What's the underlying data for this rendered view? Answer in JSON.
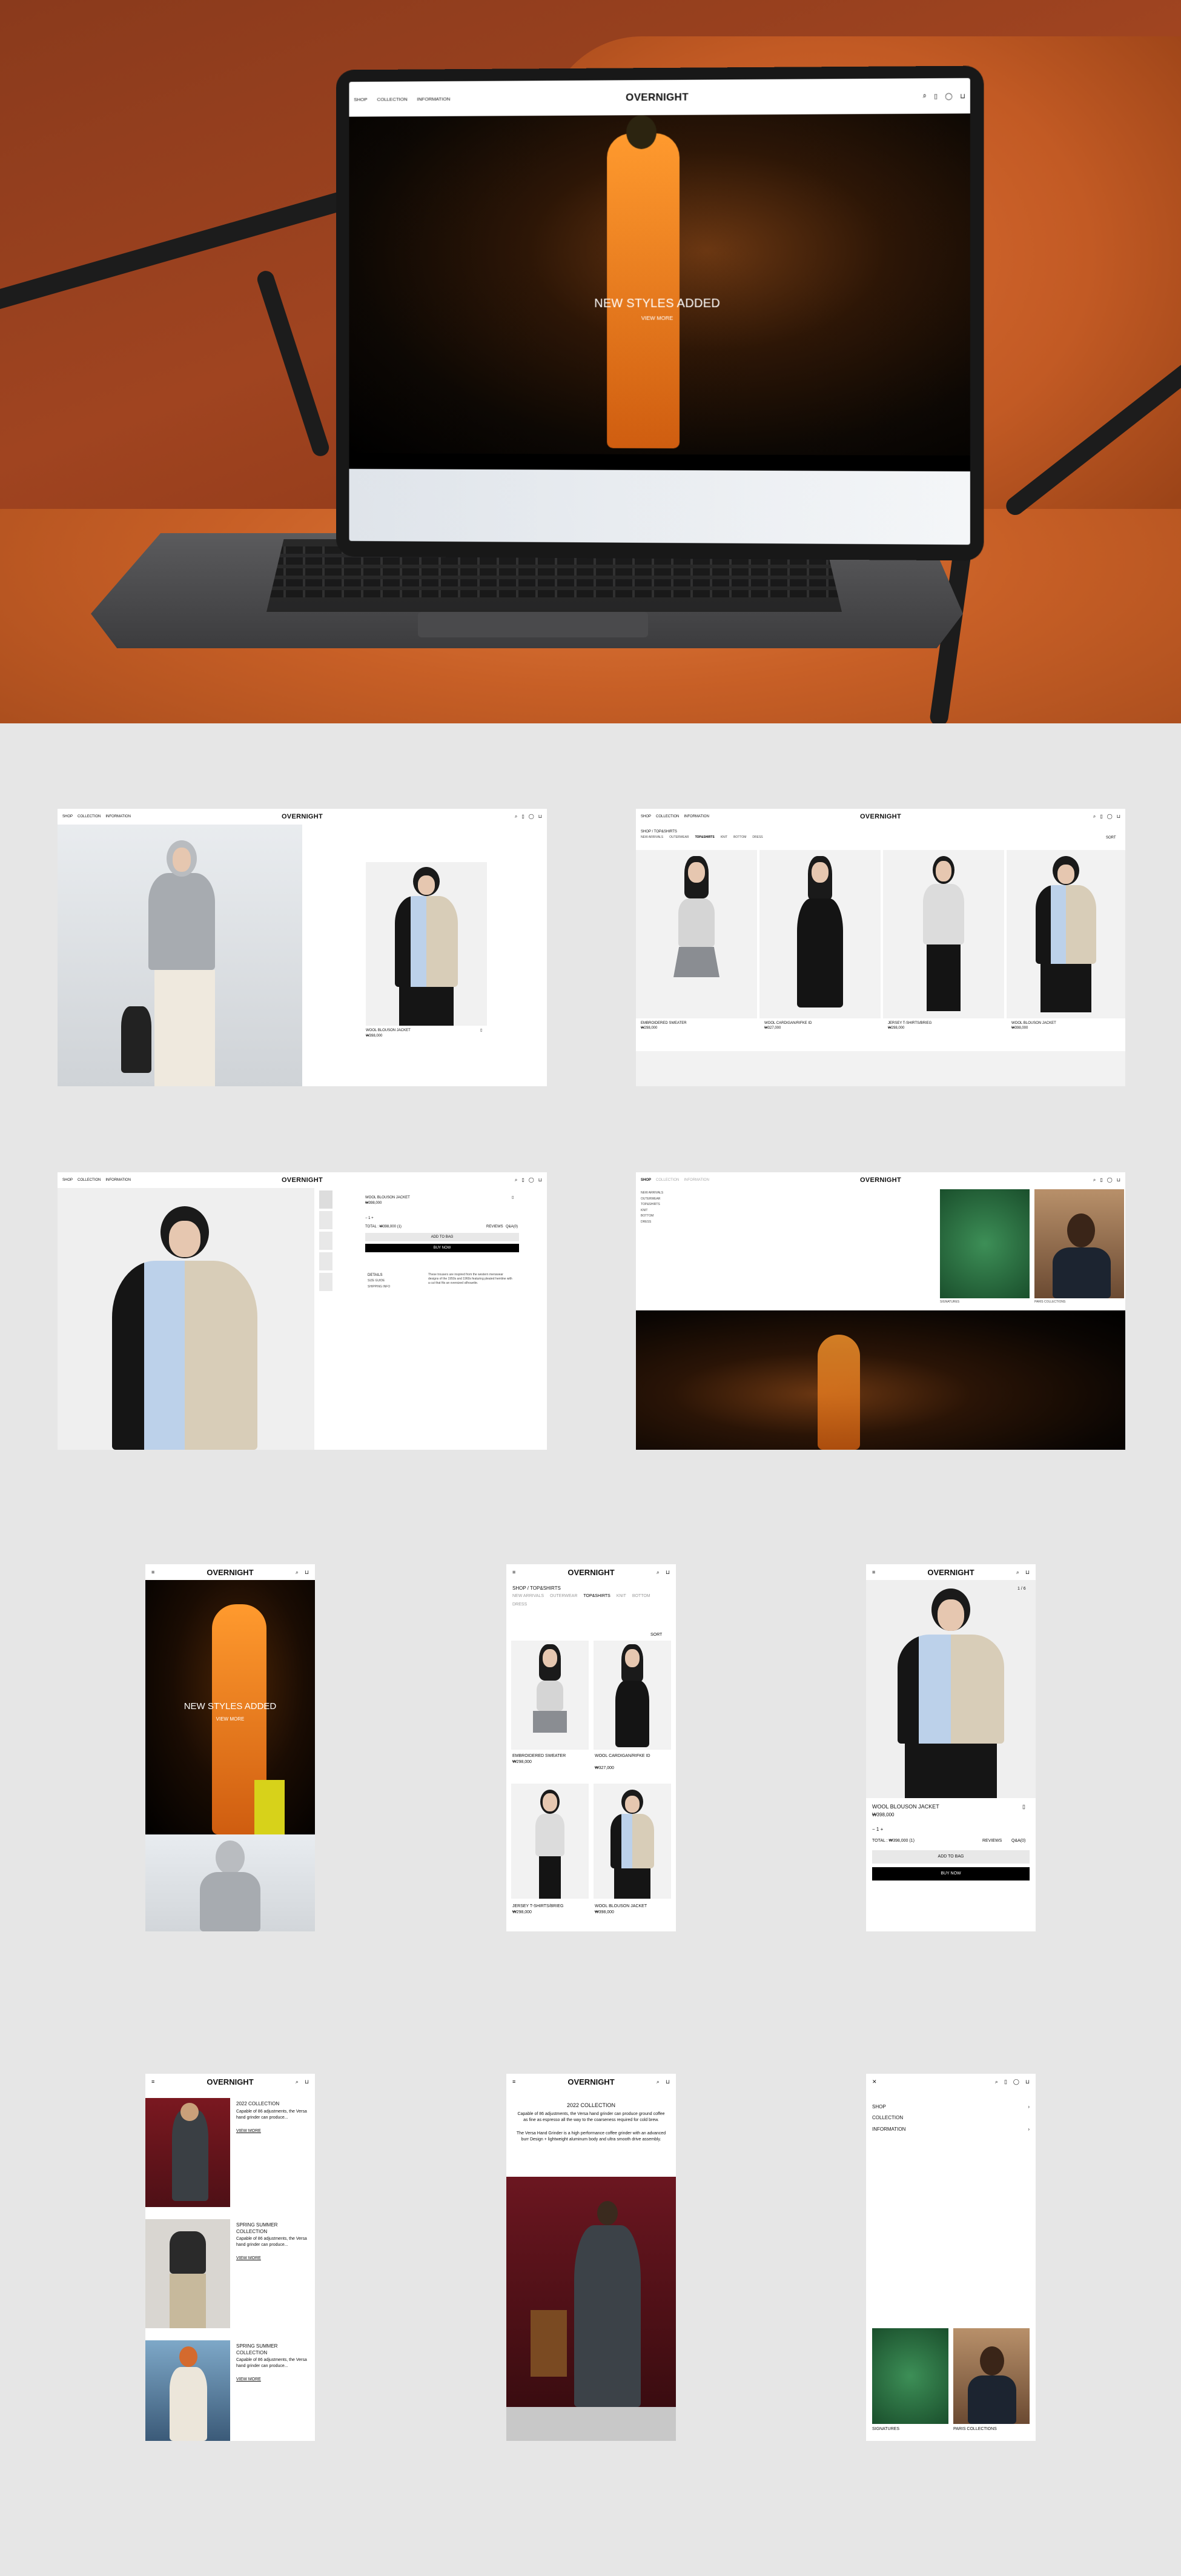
{
  "brand": "OVERNIGHT",
  "nav": {
    "shop": "SHOP",
    "collection": "COLLECTION",
    "information": "INFORMATION"
  },
  "icons": {
    "search": "⌕",
    "bookmark": "▯",
    "user": "◯",
    "bag": "⊔",
    "menu": "≡",
    "close": "✕",
    "chevron": "›"
  },
  "hero": {
    "headline": "NEW STYLES ADDED",
    "link": "VIEW MORE"
  },
  "desktop_product_preview": {
    "name": "WOOL BLOUSON JACKET",
    "price": "₩398,000"
  },
  "listing": {
    "breadcrumb": "SHOP / TOP&SHIRTS",
    "filters": [
      "NEW ARRIVALS",
      "OUTERWEAR",
      "TOP&SHIRTS",
      "KNIT",
      "BOTTOM",
      "DRESS"
    ],
    "sort": "SORT",
    "products": [
      {
        "name": "EMBROIDERED SWEATER",
        "price": "₩298,000"
      },
      {
        "name": "WOOL CARDIGAN/RIFKE ID",
        "price": "₩327,000"
      },
      {
        "name": "JERSEY T-SHIRTS/BRIEG",
        "price": "₩298,000"
      },
      {
        "name": "WOOL BLOUSON JACKET",
        "price": "₩398,000"
      }
    ]
  },
  "product_detail": {
    "name": "WOOL BLOUSON JACKET",
    "price": "₩398,000",
    "qty": "1",
    "total": "TOTAL : ₩398,000 (1)",
    "reviews": "REVIEWS",
    "qna": "Q&A(0)",
    "add_to_bag": "ADD TO BAG",
    "buy_now": "BUY NOW",
    "details_tab": "DETAILS",
    "size_tab": "SIZE GUIDE",
    "shipping_tab": "SHIPPING INFO",
    "desc": "These trousers are inspired from the western menswear designs of the 1950s and 1960s featuring pleated hemline with a cut that fits an oversized silhouette.",
    "counter": "1 / 6"
  },
  "shop_menu": {
    "items": [
      "NEW ARRIVALS",
      "OUTERWEAR",
      "TOP&SHIRTS",
      "KNIT",
      "BOTTOM",
      "DRESS"
    ],
    "cards": [
      "SIGNATURES",
      "PARIS COLLECTIONS"
    ]
  },
  "collections": {
    "list": [
      {
        "title": "2022 COLLECTION",
        "text": "Capable of 86 adjustments, the Versa hand grinder can produce...",
        "link": "VIEW MORE"
      },
      {
        "title": "SPRING SUMMER COLLECTION",
        "text": "Capable of 86 adjustments, the Versa hand grinder can produce...",
        "link": "VIEW MORE"
      },
      {
        "title": "SPRING SUMMER COLLECTION",
        "text": "Capable of 86 adjustments, the Versa hand grinder can produce...",
        "link": "VIEW MORE"
      }
    ],
    "detail_title": "2022 COLLECTION",
    "detail_text_1": "Capable of 86 adjustments, the Versa hand grinder can produce ground coffee as fine as espresso all the way to the coarseness required for cold brew.",
    "detail_text_2": "The Versa Hand Grinder is a high performance coffee grinder with an advanced burr Design + lightweight aluminum body and ultra smooth drive assembly."
  },
  "mobile_menu": {
    "items": [
      "SHOP",
      "COLLECTION",
      "INFORMATION"
    ],
    "cards": [
      "SIGNATURES",
      "PARIS COLLECTIONS"
    ]
  }
}
